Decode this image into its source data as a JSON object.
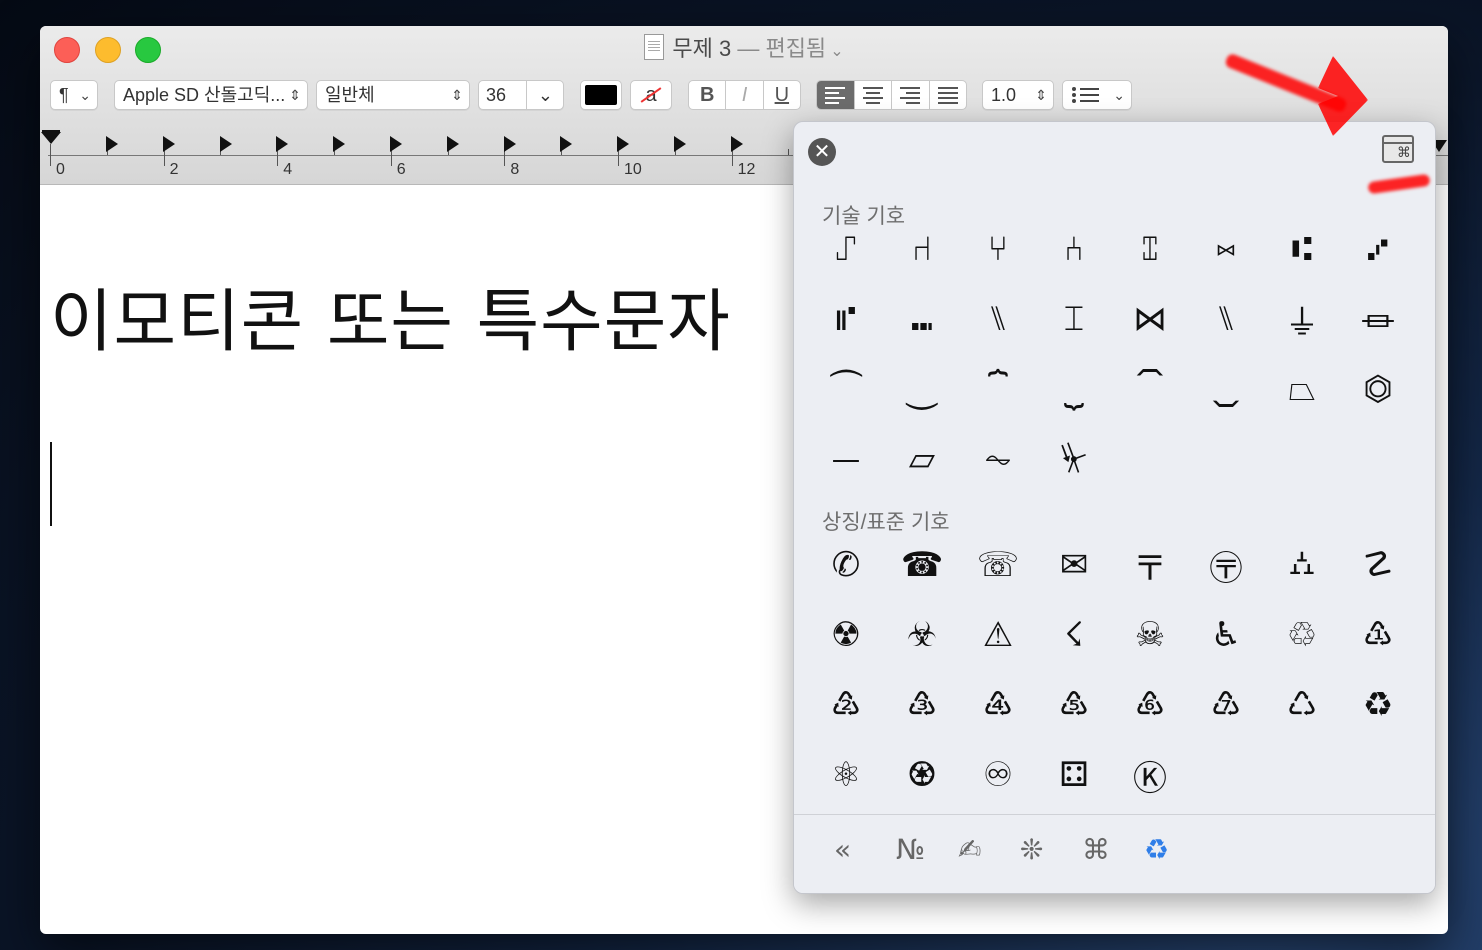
{
  "window": {
    "title": "무제 3",
    "edited": "— 편집됨",
    "title_chevron": "⌄"
  },
  "toolbar": {
    "paragraph_style": "¶",
    "font_family": "Apple SD 산돌고딕...",
    "font_style": "일반체",
    "font_size": "36",
    "bold": "B",
    "italic": "I",
    "underline": "U",
    "line_spacing": "1.0",
    "text_color": "#000000",
    "highlight_label": "a"
  },
  "ruler": {
    "numbers": [
      "0",
      "2",
      "4",
      "6",
      "8",
      "10",
      "12"
    ]
  },
  "document": {
    "text": "이모티콘 또는 특수문자"
  },
  "panel": {
    "section1": {
      "title": "기술 기호",
      "symbols": [
        "⑀",
        "⑁",
        "⑂",
        "⑃",
        "⑄",
        "⑅",
        "⑆",
        "⑇",
        "⑈",
        "⑉",
        "⑊",
        "⌶",
        "⋈",
        "⑊",
        "⏚",
        "⏛",
        "⏜",
        "⏝",
        "⏞",
        "⏟",
        "⏠",
        "⏡",
        "⏢",
        "⏣",
        "⏤",
        "⏥",
        "⏦",
        "⏧"
      ]
    },
    "section2": {
      "title": "상징/표준 기호",
      "symbols": [
        "✆",
        "☎",
        "☏",
        "✉",
        "〒",
        "〶",
        "⛼",
        "☡",
        "☢",
        "☣",
        "⚠",
        "☇",
        "☠",
        "♿",
        "♲",
        "♳",
        "♴",
        "♵",
        "♶",
        "♷",
        "♸",
        "♹",
        "♺",
        "♻",
        "⚛",
        "♼",
        "♾",
        "⚃",
        "Ⓚ"
      ]
    },
    "categories": [
      "«",
      "№",
      "✍",
      "❊",
      "⌘",
      "♻"
    ],
    "accent_color": "#2f7ee8"
  }
}
